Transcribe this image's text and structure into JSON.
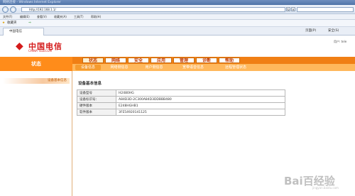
{
  "browser": {
    "title": "网络连接 - Windows Internet Explorer",
    "address": "http://192.168.1.1/",
    "menus": [
      "文件(F)",
      "编辑(E)",
      "查看(V)",
      "收藏夹(A)",
      "工具(T)",
      "帮助(H)"
    ],
    "favorites_label": "收藏夹",
    "tab_title": "中国电信",
    "cmd_page": "页面(P)",
    "cmd_safety": "安全(S)"
  },
  "header": {
    "logo_cn": "中国电信",
    "logo_en": "CHINA TELECOM",
    "user_label": "用户: tele"
  },
  "sidebar": {
    "state_label": "状态",
    "item_label": "设备基本信息"
  },
  "main_tabs": [
    "状态",
    "网络",
    "安全",
    "应用",
    "管理",
    "诊断",
    "帮助"
  ],
  "sub_tabs": [
    "设备信息",
    "网络侧信息",
    "用户侧信息",
    "宽带语音信息",
    "远程管理状态"
  ],
  "section": {
    "title": "设备基本信息",
    "rows": [
      {
        "key": "设备型号",
        "value": "H2480HG"
      },
      {
        "key": "设备标识号：",
        "value": "A84D3D-2C300A84D3DDBBB480"
      },
      {
        "key": "硬件版本",
        "value": "E248HGHB1"
      },
      {
        "key": "软件版本",
        "value": "3FE54920141125"
      }
    ]
  },
  "watermark": {
    "text": "Bai百经验",
    "sub": "jingyan.baidu.com"
  }
}
